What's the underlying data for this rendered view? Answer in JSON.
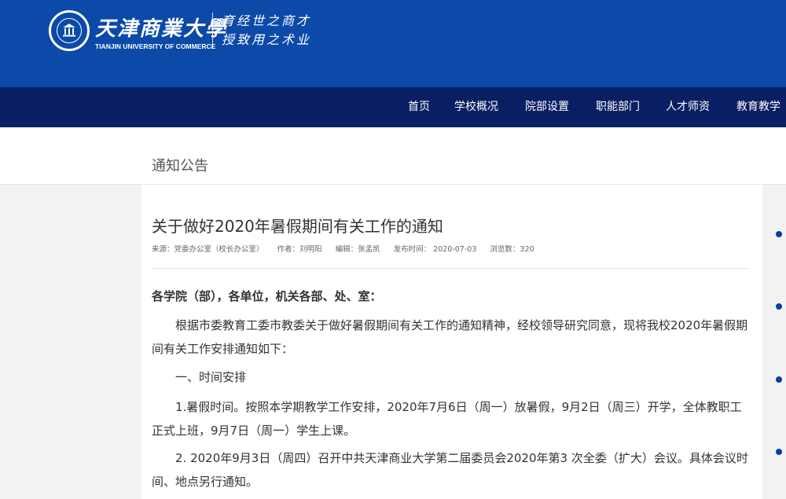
{
  "header": {
    "school_name_cn": "天津商業大學",
    "school_name_en": "TIANJIN UNIVERSITY OF COMMERCE",
    "motto_line1": "育经世之商才",
    "motto_line2": "授致用之术业",
    "brand_color": "#0b4aa8"
  },
  "nav": {
    "items": [
      {
        "label": "首页"
      },
      {
        "label": "学校概况"
      },
      {
        "label": "院部设置"
      },
      {
        "label": "职能部门"
      },
      {
        "label": "人才师资"
      },
      {
        "label": "教育教学"
      }
    ],
    "background": "#0a1f63"
  },
  "section": {
    "title": "通知公告"
  },
  "article": {
    "title": "关于做好2020年暑假期间有关工作的通知",
    "meta": {
      "source": "来源：党委办公室（校长办公室）",
      "author": "作者：刘明阳",
      "editor": "编辑：张孟凯",
      "published": "发布时间： 2020-07-03",
      "views": "浏览数：320"
    },
    "salutation": "各学院（部），各单位，机关各部、处、室：",
    "paragraphs": [
      "根据市委教育工委市教委关于做好暑假期间有关工作的通知精神，经校领导研究同意，现将我校2020年暑假期间有关工作安排通知如下：",
      "一、时间安排",
      "1.暑假时间。按照本学期教学工作安排，2020年7月6日（周一）放暑假，9月2日（周三）开学，全体教职工正式上班，9月7日（周一）学生上课。",
      "2. 2020年9月3日（周四）召开中共天津商业大学第二届委员会2020年第3 次全委（扩大）会议。具体会议时间、地点另行通知。"
    ]
  }
}
